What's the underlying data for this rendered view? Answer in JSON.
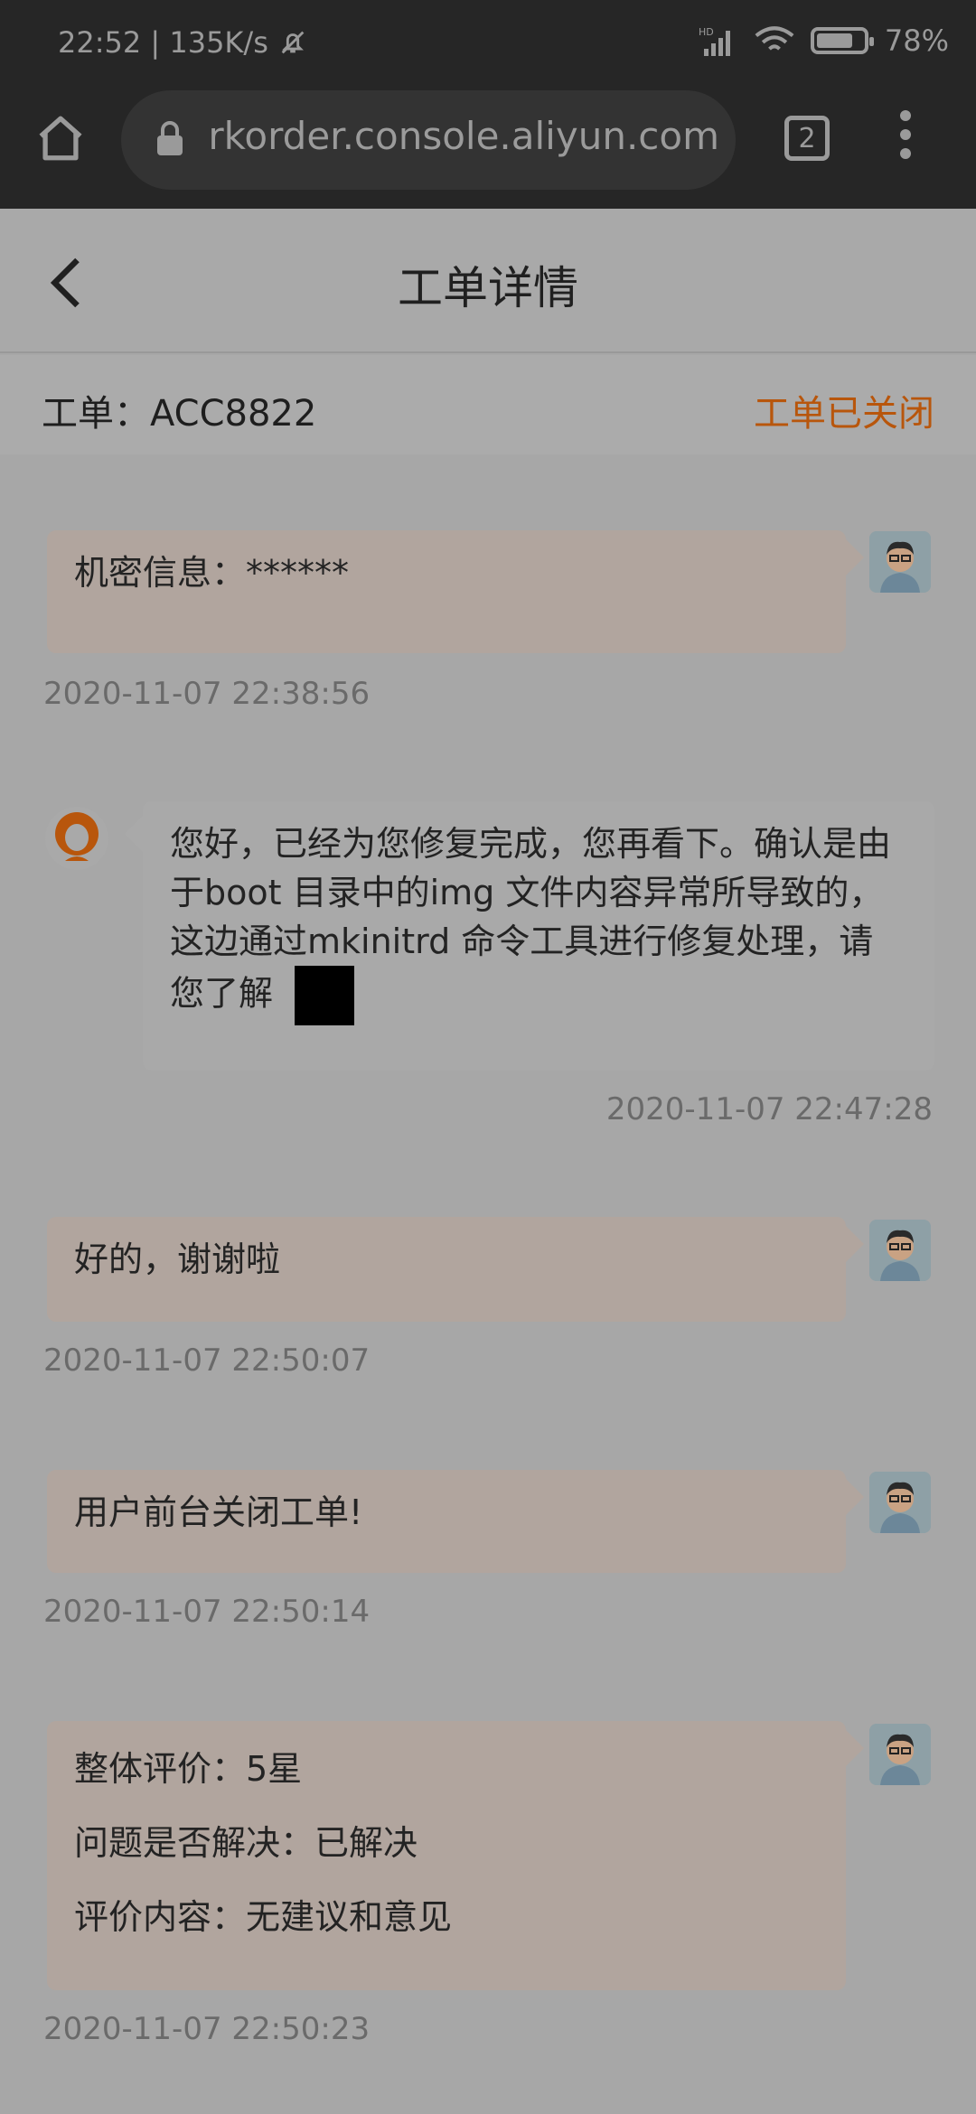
{
  "status_bar": {
    "time_speed": "22:52 | 135K/s",
    "signal_label": "HD",
    "battery_percent": "78%",
    "battery_level": 0.78
  },
  "browser": {
    "url": "workorder.console.aliyun.com",
    "tab_count": "2"
  },
  "header": {
    "title": "工单详情"
  },
  "ticket": {
    "id_label": "工单：ACC8822",
    "status": "工单已关闭"
  },
  "messages": [
    {
      "sender": "user",
      "text": "机密信息：******",
      "time": "2020-11-07 22:38:56"
    },
    {
      "sender": "agent",
      "text": "您好，已经为您修复完成，您再看下。确认是由于boot 目录中的img 文件内容异常所导致的，这边通过mkinitrd 命令工具进行修复处理，请您了解",
      "time": "2020-11-07 22:47:28"
    },
    {
      "sender": "user",
      "text": "好的，谢谢啦",
      "time": "2020-11-07 22:50:07"
    },
    {
      "sender": "user",
      "text": "用户前台关闭工单!",
      "time": "2020-11-07 22:50:14"
    },
    {
      "sender": "user",
      "lines": [
        "整体评价：5星",
        "问题是否解决：已解决",
        "评价内容：无建议和意见"
      ],
      "time": "2020-11-07 22:50:23"
    }
  ],
  "colors": {
    "status_closed": "#b8560c",
    "user_bubble": "#b1a59e",
    "agent_bubble": "#a9a9a9"
  }
}
